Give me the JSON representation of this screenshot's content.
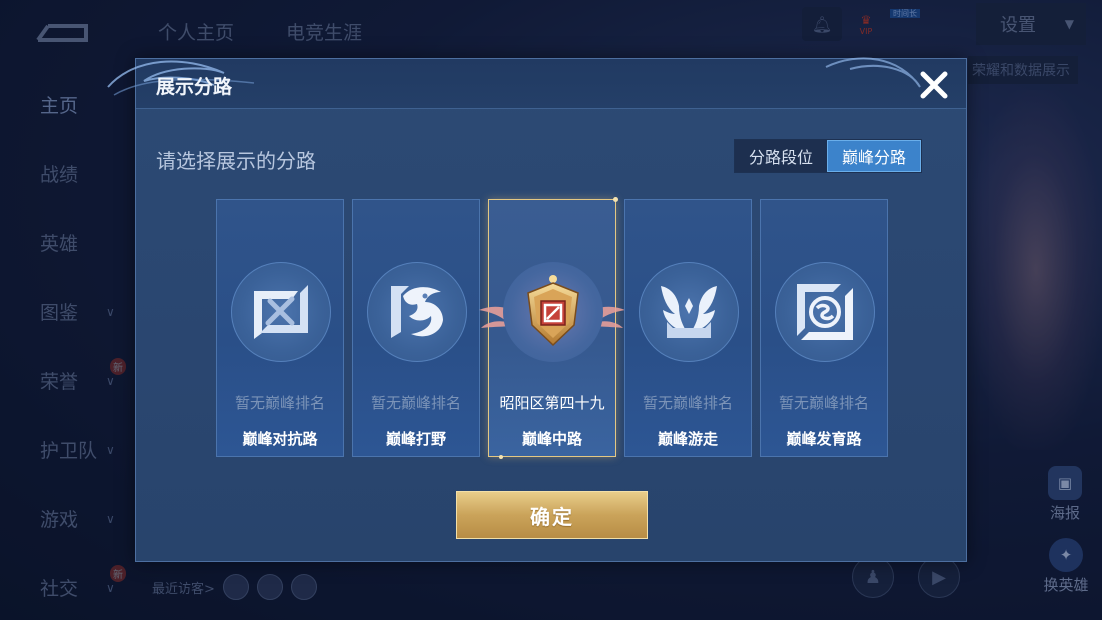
{
  "background": {
    "top_tabs": [
      "个人主页",
      "电竞生涯"
    ],
    "settings_label": "设置",
    "vip_label": "VIP",
    "vip_tag": "时间长",
    "behind_label": "荣耀和数据展示",
    "side_nav": [
      {
        "label": "主页",
        "active": true,
        "chevron": false,
        "new": false
      },
      {
        "label": "战绩",
        "active": false,
        "chevron": false,
        "new": false
      },
      {
        "label": "英雄",
        "active": false,
        "chevron": false,
        "new": false
      },
      {
        "label": "图鉴",
        "active": false,
        "chevron": true,
        "new": false
      },
      {
        "label": "荣誉",
        "active": false,
        "chevron": true,
        "new": true
      },
      {
        "label": "护卫队",
        "active": false,
        "chevron": true,
        "new": false
      },
      {
        "label": "游戏",
        "active": false,
        "chevron": true,
        "new": false
      },
      {
        "label": "社交",
        "active": false,
        "chevron": true,
        "new": true
      }
    ],
    "new_badge": "新",
    "recent_visitors_label": "最近访客>",
    "poster_label": "海报",
    "swap_hero_label": "换英雄"
  },
  "modal": {
    "title": "展示分路",
    "subtitle": "请选择展示的分路",
    "segments": [
      {
        "label": "分路段位",
        "active": false
      },
      {
        "label": "巅峰分路",
        "active": true
      }
    ],
    "cards": [
      {
        "rank": "暂无巅峰排名",
        "lane": "巅峰对抗路",
        "icon": "sword-lane-icon",
        "selected": false
      },
      {
        "rank": "暂无巅峰排名",
        "lane": "巅峰打野",
        "icon": "dragon-jungle-icon",
        "selected": false
      },
      {
        "rank": "昭阳区第四十九",
        "lane": "巅峰中路",
        "icon": "gold-shield-badge-icon",
        "selected": true
      },
      {
        "rank": "暂无巅峰排名",
        "lane": "巅峰游走",
        "icon": "wings-roam-icon",
        "selected": false
      },
      {
        "rank": "暂无巅峰排名",
        "lane": "巅峰发育路",
        "icon": "target-marksman-icon",
        "selected": false
      }
    ],
    "confirm_label": "确定"
  },
  "colors": {
    "accent_blue": "#3c83cb",
    "gold": "#caa35a",
    "modal_bg": "#2c4a74"
  }
}
